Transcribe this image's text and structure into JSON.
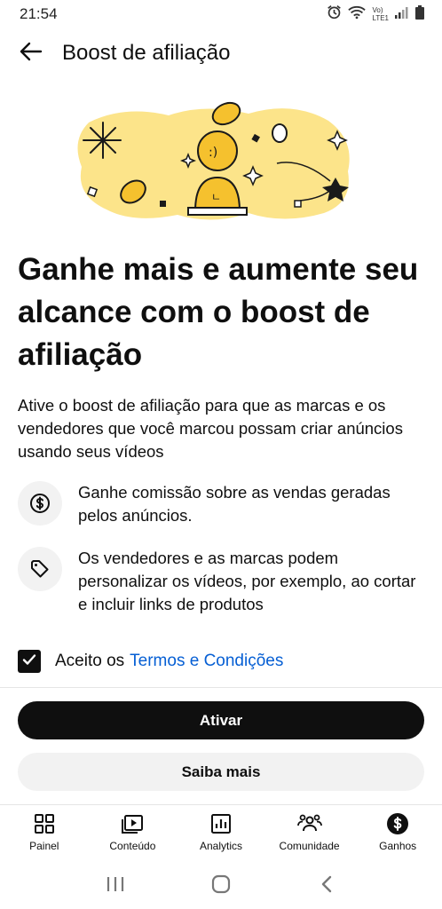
{
  "status_bar": {
    "time": "21:54",
    "network_label_top": "Vo)",
    "network_label_bottom": "LTE1",
    "icons": [
      "alarm-icon",
      "wifi-icon",
      "signal-icon",
      "battery-icon"
    ]
  },
  "app_bar": {
    "title": "Boost de afiliação",
    "back_icon": "arrow-left-icon"
  },
  "hero": {
    "illustration": "coins-and-sparkles-illustration",
    "accent_color": "#fce48a",
    "coin_color": "#f5c12e"
  },
  "headline": "Ganhe mais e aumente seu alcance com o boost de afiliação",
  "description": "Ative o boost de afiliação para que as marcas e os vendedores que você marcou possam criar anúncios usando seus vídeos",
  "features": [
    {
      "icon": "dollar-circle-icon",
      "text": "Ganhe comissão sobre as vendas geradas pelos anúncios."
    },
    {
      "icon": "tag-icon",
      "text": "Os vendedores e as marcas podem personalizar os vídeos, por exemplo, ao cortar e incluir links de produtos"
    }
  ],
  "terms": {
    "checked": true,
    "label": "Aceito os",
    "link": "Termos e Condições",
    "link_color": "#065fd4"
  },
  "buttons": {
    "primary": "Ativar",
    "secondary": "Saiba mais"
  },
  "bottom_nav": {
    "items": [
      {
        "label": "Painel",
        "icon": "dashboard-icon"
      },
      {
        "label": "Conteúdo",
        "icon": "content-icon"
      },
      {
        "label": "Analytics",
        "icon": "analytics-icon"
      },
      {
        "label": "Comunidade",
        "icon": "community-icon"
      },
      {
        "label": "Ganhos",
        "icon": "earn-icon",
        "active": true
      }
    ]
  },
  "system_nav": {
    "icons": [
      "recents-icon",
      "home-icon",
      "back-icon"
    ]
  }
}
